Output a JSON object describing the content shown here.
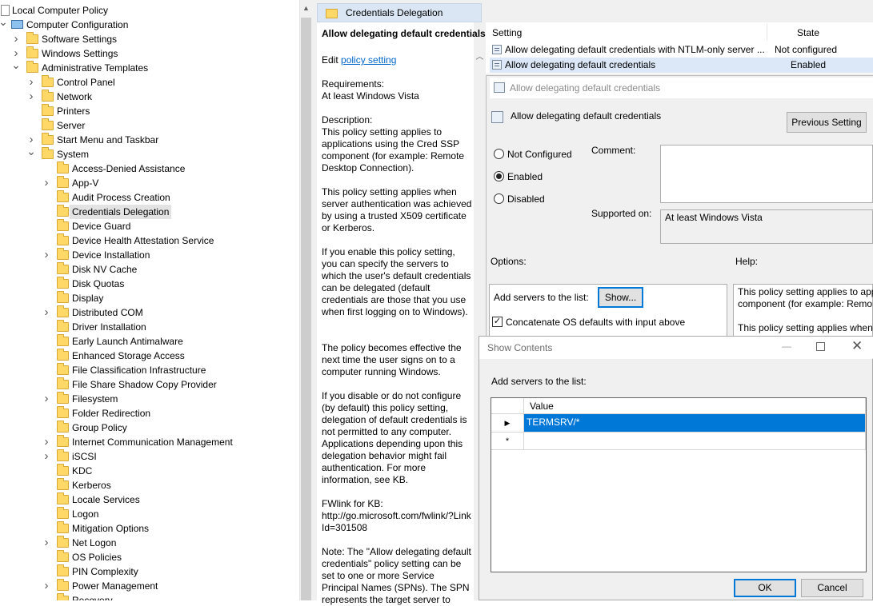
{
  "tree": {
    "root": "Local Computer Policy",
    "computer_config": "Computer Configuration",
    "software_settings": "Software Settings",
    "windows_settings": "Windows Settings",
    "admin_templates": "Administrative Templates",
    "control_panel": "Control Panel",
    "network": "Network",
    "printers": "Printers",
    "server": "Server",
    "start_menu": "Start Menu and Taskbar",
    "system": "System",
    "system_children": [
      "Access-Denied Assistance",
      "App-V",
      "Audit Process Creation",
      "Credentials Delegation",
      "Device Guard",
      "Device Health Attestation Service",
      "Device Installation",
      "Disk NV Cache",
      "Disk Quotas",
      "Display",
      "Distributed COM",
      "Driver Installation",
      "Early Launch Antimalware",
      "Enhanced Storage Access",
      "File Classification Infrastructure",
      "File Share Shadow Copy Provider",
      "Filesystem",
      "Folder Redirection",
      "Group Policy",
      "Internet Communication Management",
      "iSCSI",
      "KDC",
      "Kerberos",
      "Locale Services",
      "Logon",
      "Mitigation Options",
      "Net Logon",
      "OS Policies",
      "PIN Complexity",
      "Power Management",
      "Recovery"
    ],
    "selected": "Credentials Delegation"
  },
  "header": {
    "title": "Credentials Delegation"
  },
  "description": {
    "heading": "Allow delegating default credentials",
    "edit_prefix": "Edit ",
    "edit_link": "policy setting",
    "requirements": "Requirements:\nAt least Windows Vista",
    "para1": "Description:\nThis policy setting applies to applications using the Cred SSP component (for example: Remote Desktop Connection).",
    "para2": "This policy setting applies when server authentication was achieved by using a trusted X509 certificate or Kerberos.",
    "para3": "If you enable this policy setting, you can specify the servers to which the user's default credentials can be delegated (default credentials are those that you use when first logging on to Windows).",
    "para4": "The policy becomes effective the next time the user signs on to a computer running Windows.",
    "para5": "If you disable or do not configure (by default) this policy setting, delegation of default credentials is not permitted to any computer. Applications depending upon this delegation behavior might fail authentication. For more information, see KB.",
    "para6": "FWlink for KB:\nhttp://go.microsoft.com/fwlink/?LinkId=301508",
    "para7": "Note: The \"Allow delegating default credentials\" policy setting can be set to one or more Service Principal Names (SPNs). The SPN represents the target server to"
  },
  "settings_list": {
    "col_setting": "Setting",
    "col_state": "State",
    "rows": [
      {
        "name": "Allow delegating default credentials with NTLM-only server ...",
        "state": "Not configured"
      },
      {
        "name": "Allow delegating default credentials",
        "state": "Enabled"
      }
    ]
  },
  "policy_dialog": {
    "title": "Allow delegating default credentials",
    "policy_name": "Allow delegating default credentials",
    "prev_button": "Previous Setting",
    "radio_not_configured": "Not Configured",
    "radio_enabled": "Enabled",
    "radio_disabled": "Disabled",
    "selected_radio": "Enabled",
    "comment_label": "Comment:",
    "supported_label": "Supported on:",
    "supported_value": "At least Windows Vista",
    "options_label": "Options:",
    "help_label": "Help:",
    "add_servers_label": "Add servers to the list:",
    "show_button": "Show...",
    "concat_label": "Concatenate OS defaults with input above",
    "concat_checked": true,
    "help_line1": "This policy setting applies to app",
    "help_line2": "component (for example: Remo",
    "help_line3": "This policy setting applies when"
  },
  "show_contents": {
    "title": "Show Contents",
    "label": "Add servers to the list:",
    "column": "Value",
    "rows": [
      "TERMSRV/*",
      ""
    ],
    "ok": "OK",
    "cancel": "Cancel"
  },
  "colors": {
    "selection": "#0078d7",
    "link": "#0066cc",
    "folder": "#ffd867"
  }
}
